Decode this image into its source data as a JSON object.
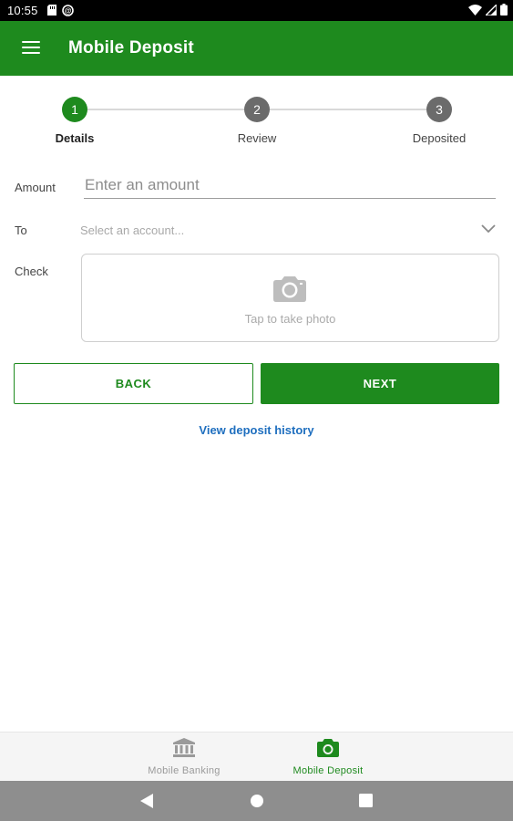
{
  "status_bar": {
    "time": "10:55",
    "icons_left": [
      "sd-card-icon",
      "sync-icon"
    ],
    "icons_right": [
      "wifi-icon",
      "signal-icon",
      "battery-icon"
    ]
  },
  "app_bar": {
    "title": "Mobile Deposit",
    "menu_icon": "hamburger-menu-icon"
  },
  "stepper": {
    "steps": [
      {
        "number": "1",
        "label": "Details",
        "active": true
      },
      {
        "number": "2",
        "label": "Review",
        "active": false
      },
      {
        "number": "3",
        "label": "Deposited",
        "active": false
      }
    ]
  },
  "form": {
    "amount": {
      "label": "Amount",
      "placeholder": "Enter an amount",
      "value": ""
    },
    "to": {
      "label": "To",
      "placeholder": "Select an account..."
    },
    "check": {
      "label": "Check",
      "prompt": "Tap to take photo",
      "icon": "camera-icon"
    }
  },
  "buttons": {
    "back": "BACK",
    "next": "NEXT"
  },
  "history_link": "View deposit history",
  "bottom_nav": {
    "items": [
      {
        "label": "Mobile Banking",
        "icon": "bank-icon",
        "active": false
      },
      {
        "label": "Mobile Deposit",
        "icon": "camera-icon",
        "active": true
      }
    ]
  },
  "system_nav": {
    "buttons": [
      "back-triangle-icon",
      "home-circle-icon",
      "recents-square-icon"
    ]
  },
  "colors": {
    "brand_green": "#1e8a1e",
    "link_blue": "#1f6fbf",
    "inactive_gray": "#6b6b6b",
    "status_bar": "#000000",
    "system_nav": "#8e8e8e"
  }
}
